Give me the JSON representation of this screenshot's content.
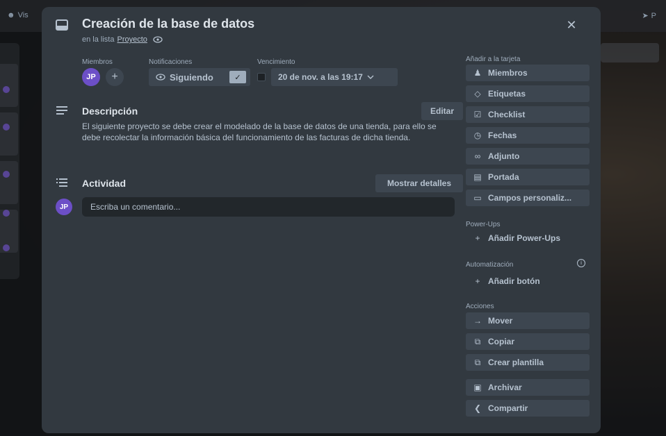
{
  "background": {
    "topbar_left": "Vis",
    "topbar_right": "P"
  },
  "card": {
    "title": "Creación de la base de datos",
    "list_prefix": "en la lista",
    "list_name": "Proyecto"
  },
  "meta": {
    "members_label": "Miembros",
    "member_initials": "JP",
    "notifications_label": "Notificaciones",
    "following_label": "Siguiendo",
    "due_label": "Vencimiento",
    "due_value": "20 de nov. a las 19:17"
  },
  "description": {
    "title": "Descripción",
    "edit_label": "Editar",
    "text": "El siguiente proyecto se debe crear el modelado de la base de datos de una tienda, para ello se debe recolectar la información básica del funcionamiento de las facturas de dicha tienda."
  },
  "activity": {
    "title": "Actividad",
    "details_label": "Mostrar detalles",
    "comment_avatar": "JP",
    "comment_placeholder": "Escriba un comentario..."
  },
  "sidebar": {
    "add_label": "Añadir a la tarjeta",
    "add_items": [
      {
        "label": "Miembros",
        "icon": "person-icon"
      },
      {
        "label": "Etiquetas",
        "icon": "tag-icon"
      },
      {
        "label": "Checklist",
        "icon": "checklist-icon"
      },
      {
        "label": "Fechas",
        "icon": "clock-icon"
      },
      {
        "label": "Adjunto",
        "icon": "paperclip-icon"
      },
      {
        "label": "Portada",
        "icon": "cover-icon"
      },
      {
        "label": "Campos personaliz...",
        "icon": "custom-fields-icon"
      }
    ],
    "powerups_label": "Power-Ups",
    "add_powerups": "Añadir Power-Ups",
    "automation_label": "Automatización",
    "add_button": "Añadir botón",
    "actions_label": "Acciones",
    "actions": [
      {
        "label": "Mover",
        "icon": "arrow-right-icon"
      },
      {
        "label": "Copiar",
        "icon": "copy-icon"
      },
      {
        "label": "Crear plantilla",
        "icon": "template-icon"
      },
      {
        "label": "Archivar",
        "icon": "archive-icon"
      },
      {
        "label": "Compartir",
        "icon": "share-icon"
      }
    ]
  }
}
